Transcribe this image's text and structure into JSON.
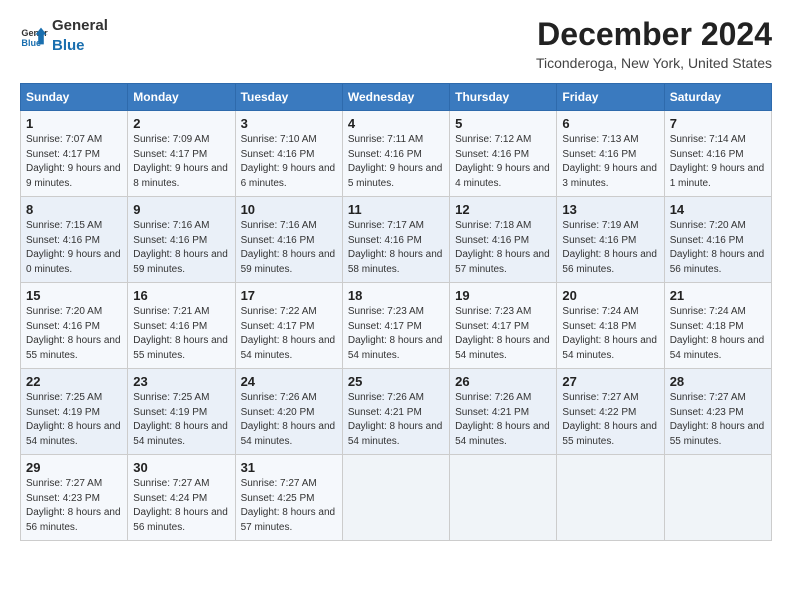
{
  "logo": {
    "line1": "General",
    "line2": "Blue"
  },
  "title": "December 2024",
  "subtitle": "Ticonderoga, New York, United States",
  "headers": [
    "Sunday",
    "Monday",
    "Tuesday",
    "Wednesday",
    "Thursday",
    "Friday",
    "Saturday"
  ],
  "weeks": [
    [
      {
        "day": "1",
        "sunrise": "7:07 AM",
        "sunset": "4:17 PM",
        "daylight": "9 hours and 9 minutes."
      },
      {
        "day": "2",
        "sunrise": "7:09 AM",
        "sunset": "4:17 PM",
        "daylight": "9 hours and 8 minutes."
      },
      {
        "day": "3",
        "sunrise": "7:10 AM",
        "sunset": "4:16 PM",
        "daylight": "9 hours and 6 minutes."
      },
      {
        "day": "4",
        "sunrise": "7:11 AM",
        "sunset": "4:16 PM",
        "daylight": "9 hours and 5 minutes."
      },
      {
        "day": "5",
        "sunrise": "7:12 AM",
        "sunset": "4:16 PM",
        "daylight": "9 hours and 4 minutes."
      },
      {
        "day": "6",
        "sunrise": "7:13 AM",
        "sunset": "4:16 PM",
        "daylight": "9 hours and 3 minutes."
      },
      {
        "day": "7",
        "sunrise": "7:14 AM",
        "sunset": "4:16 PM",
        "daylight": "9 hours and 1 minute."
      }
    ],
    [
      {
        "day": "8",
        "sunrise": "7:15 AM",
        "sunset": "4:16 PM",
        "daylight": "9 hours and 0 minutes."
      },
      {
        "day": "9",
        "sunrise": "7:16 AM",
        "sunset": "4:16 PM",
        "daylight": "8 hours and 59 minutes."
      },
      {
        "day": "10",
        "sunrise": "7:16 AM",
        "sunset": "4:16 PM",
        "daylight": "8 hours and 59 minutes."
      },
      {
        "day": "11",
        "sunrise": "7:17 AM",
        "sunset": "4:16 PM",
        "daylight": "8 hours and 58 minutes."
      },
      {
        "day": "12",
        "sunrise": "7:18 AM",
        "sunset": "4:16 PM",
        "daylight": "8 hours and 57 minutes."
      },
      {
        "day": "13",
        "sunrise": "7:19 AM",
        "sunset": "4:16 PM",
        "daylight": "8 hours and 56 minutes."
      },
      {
        "day": "14",
        "sunrise": "7:20 AM",
        "sunset": "4:16 PM",
        "daylight": "8 hours and 56 minutes."
      }
    ],
    [
      {
        "day": "15",
        "sunrise": "7:20 AM",
        "sunset": "4:16 PM",
        "daylight": "8 hours and 55 minutes."
      },
      {
        "day": "16",
        "sunrise": "7:21 AM",
        "sunset": "4:16 PM",
        "daylight": "8 hours and 55 minutes."
      },
      {
        "day": "17",
        "sunrise": "7:22 AM",
        "sunset": "4:17 PM",
        "daylight": "8 hours and 54 minutes."
      },
      {
        "day": "18",
        "sunrise": "7:23 AM",
        "sunset": "4:17 PM",
        "daylight": "8 hours and 54 minutes."
      },
      {
        "day": "19",
        "sunrise": "7:23 AM",
        "sunset": "4:17 PM",
        "daylight": "8 hours and 54 minutes."
      },
      {
        "day": "20",
        "sunrise": "7:24 AM",
        "sunset": "4:18 PM",
        "daylight": "8 hours and 54 minutes."
      },
      {
        "day": "21",
        "sunrise": "7:24 AM",
        "sunset": "4:18 PM",
        "daylight": "8 hours and 54 minutes."
      }
    ],
    [
      {
        "day": "22",
        "sunrise": "7:25 AM",
        "sunset": "4:19 PM",
        "daylight": "8 hours and 54 minutes."
      },
      {
        "day": "23",
        "sunrise": "7:25 AM",
        "sunset": "4:19 PM",
        "daylight": "8 hours and 54 minutes."
      },
      {
        "day": "24",
        "sunrise": "7:26 AM",
        "sunset": "4:20 PM",
        "daylight": "8 hours and 54 minutes."
      },
      {
        "day": "25",
        "sunrise": "7:26 AM",
        "sunset": "4:21 PM",
        "daylight": "8 hours and 54 minutes."
      },
      {
        "day": "26",
        "sunrise": "7:26 AM",
        "sunset": "4:21 PM",
        "daylight": "8 hours and 54 minutes."
      },
      {
        "day": "27",
        "sunrise": "7:27 AM",
        "sunset": "4:22 PM",
        "daylight": "8 hours and 55 minutes."
      },
      {
        "day": "28",
        "sunrise": "7:27 AM",
        "sunset": "4:23 PM",
        "daylight": "8 hours and 55 minutes."
      }
    ],
    [
      {
        "day": "29",
        "sunrise": "7:27 AM",
        "sunset": "4:23 PM",
        "daylight": "8 hours and 56 minutes."
      },
      {
        "day": "30",
        "sunrise": "7:27 AM",
        "sunset": "4:24 PM",
        "daylight": "8 hours and 56 minutes."
      },
      {
        "day": "31",
        "sunrise": "7:27 AM",
        "sunset": "4:25 PM",
        "daylight": "8 hours and 57 minutes."
      },
      null,
      null,
      null,
      null
    ]
  ],
  "labels": {
    "sunrise": "Sunrise:",
    "sunset": "Sunset:",
    "daylight": "Daylight:"
  }
}
